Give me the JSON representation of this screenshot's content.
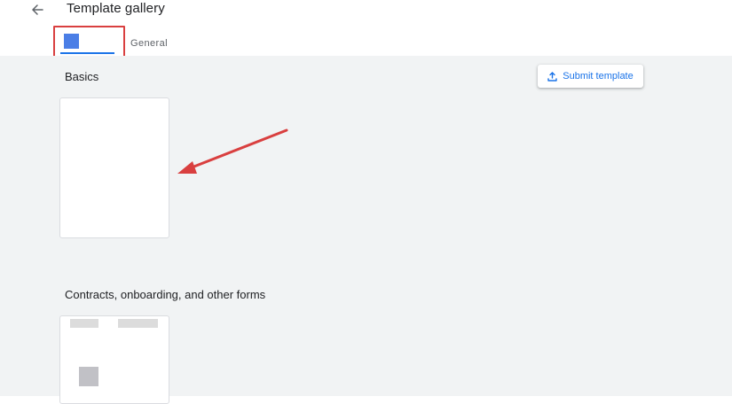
{
  "header": {
    "title": "Template gallery",
    "back_icon": "arrow-left-icon"
  },
  "tabs": [
    {
      "label": "",
      "active": true,
      "swatch_color": "#4a7ee6"
    },
    {
      "label": "General",
      "active": false
    }
  ],
  "sections": [
    {
      "title": "Basics"
    },
    {
      "title": "Contracts, onboarding, and other forms"
    }
  ],
  "submit_button": {
    "label": "Submit template",
    "icon": "upload-icon"
  },
  "colors": {
    "accent": "#1a73e8",
    "annotation": "#d93f3f",
    "background": "#f1f3f4"
  }
}
